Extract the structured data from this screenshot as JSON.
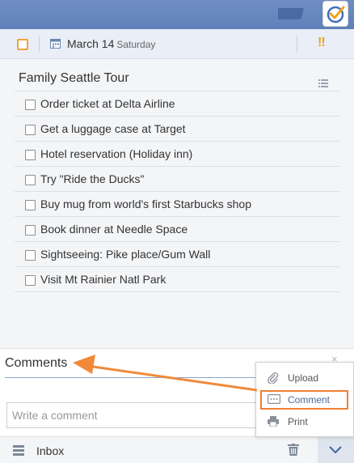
{
  "header": {
    "logo_icon": "app-logo-check-icon",
    "flag_icon": "flag-icon"
  },
  "task": {
    "date": "March 14",
    "weekday": "Saturday",
    "priority": "!!",
    "accent_color": "#f0a33a"
  },
  "list": {
    "title": "Family Seattle Tour",
    "items": [
      {
        "text": "Order ticket at Delta Airline",
        "checked": false
      },
      {
        "text": "Get a luggage case at Target",
        "checked": false
      },
      {
        "text": "Hotel reservation (Holiday inn)",
        "checked": false
      },
      {
        "text": "Try \"Ride the Ducks\"",
        "checked": false
      },
      {
        "text": "Buy mug from world's first Starbucks shop",
        "checked": false
      },
      {
        "text": "Book dinner at Needle Space",
        "checked": false
      },
      {
        "text": "Sightseeing: Pike place/Gum Wall",
        "checked": false
      },
      {
        "text": "Visit Mt Rainier Natl Park",
        "checked": false
      }
    ]
  },
  "comments": {
    "title": "Comments",
    "placeholder": "Write a comment",
    "close": "×"
  },
  "popup": {
    "upload": "Upload",
    "comment": "Comment",
    "print": "Print",
    "highlight_color": "#ef7f33"
  },
  "footer": {
    "list_name": "Inbox"
  }
}
